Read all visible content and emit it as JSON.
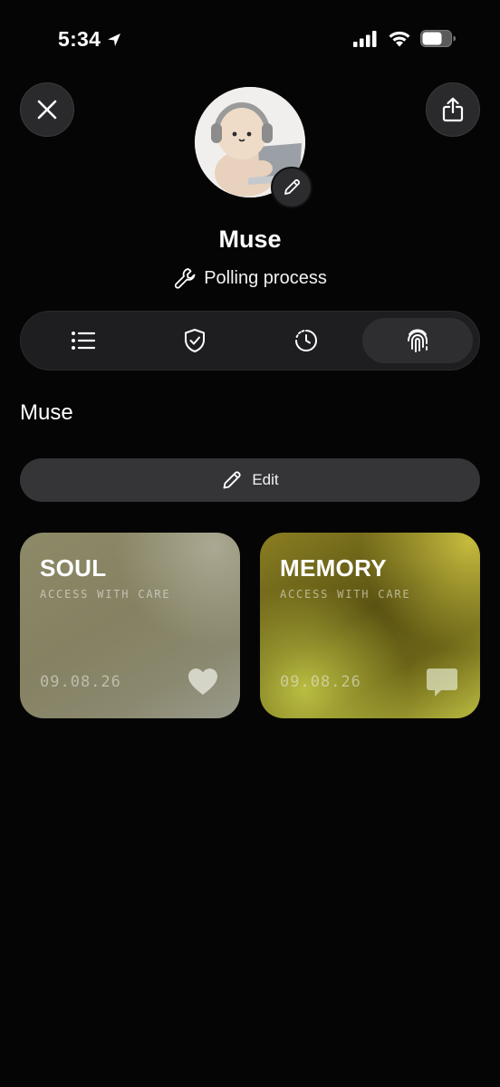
{
  "status_bar": {
    "time": "5:34",
    "icons": [
      "location-arrow-icon",
      "cellular-signal-icon",
      "wifi-icon",
      "battery-icon"
    ]
  },
  "header": {
    "close_icon": "close-icon",
    "share_icon": "share-icon",
    "avatar_edit_icon": "pencil-icon"
  },
  "profile": {
    "name": "Muse",
    "status_icon": "wrench-icon",
    "status": "Polling process"
  },
  "tabs": [
    {
      "icon": "list-icon",
      "selected": false
    },
    {
      "icon": "shield-check-icon",
      "selected": false
    },
    {
      "icon": "clock-history-icon",
      "selected": false
    },
    {
      "icon": "fingerprint-icon",
      "selected": true
    }
  ],
  "section": {
    "title": "Muse",
    "edit_label": "Edit",
    "edit_icon": "pencil-icon"
  },
  "cards": [
    {
      "title": "SOUL",
      "subtitle": "ACCESS WITH CARE",
      "date": "09.08.26",
      "icon": "heart-icon"
    },
    {
      "title": "MEMORY",
      "subtitle": "ACCESS WITH CARE",
      "date": "09.08.26",
      "icon": "chat-bubble-icon"
    }
  ],
  "colors": {
    "background": "#050505",
    "surface": "#1e1e20",
    "button": "#353537",
    "soul_card": "#8a876a",
    "memory_card": "#6b6417"
  }
}
